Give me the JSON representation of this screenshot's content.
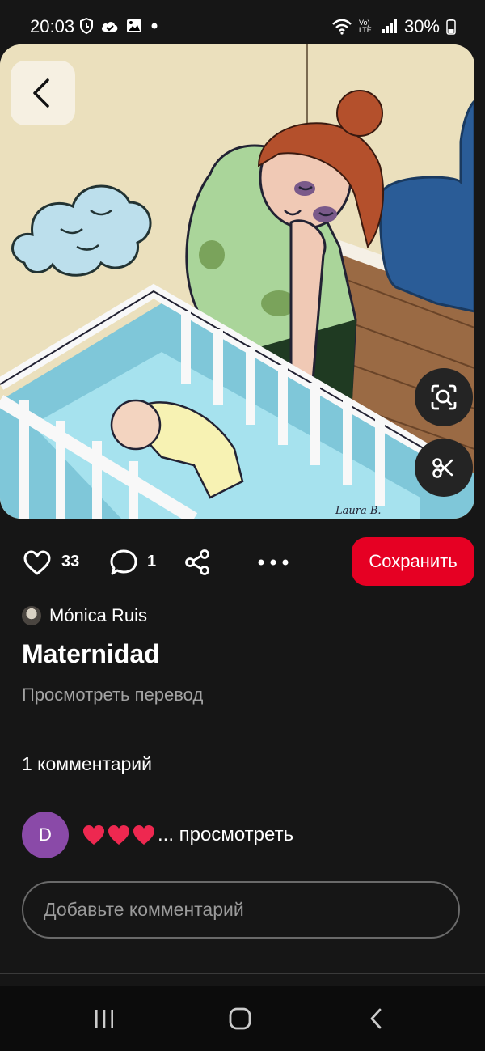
{
  "status_bar": {
    "time": "20:03",
    "battery": "30%",
    "icons_left": [
      "shield-icon",
      "cloud-check-icon",
      "gallery-icon",
      "dot-icon"
    ],
    "icons_right": [
      "wifi-icon",
      "volte-icon",
      "signal-icon",
      "battery-icon"
    ],
    "volte_label": "Vo) LTE"
  },
  "pin": {
    "image_description_icon": "illustration-image",
    "signature": "Laura B."
  },
  "actions": {
    "like_count": "33",
    "comment_count": "1",
    "save_label": "Сохранить",
    "save_color": "#e60023"
  },
  "author": {
    "name": "Mónica Ruis"
  },
  "title": "Maternidad",
  "translate_label": "Просмотреть перевод",
  "comments": {
    "count_label": "1 комментарий",
    "items": [
      {
        "avatar_letter": "D",
        "avatar_color": "#8a4aa8",
        "text": "... просмотреть"
      }
    ]
  },
  "add_comment": {
    "placeholder": "Добавьте комментарий"
  }
}
